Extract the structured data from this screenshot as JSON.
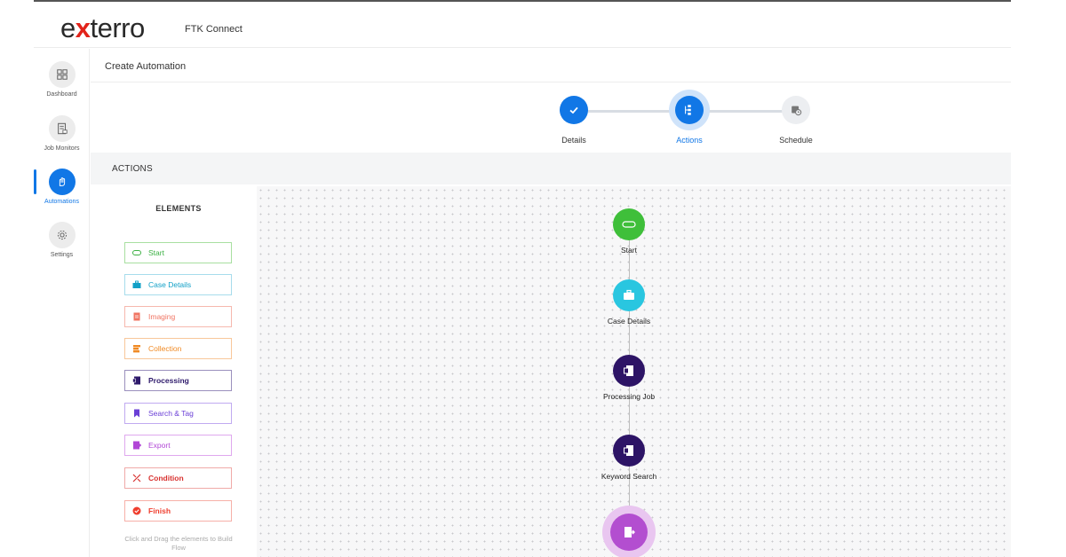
{
  "header": {
    "logo_pre": "e",
    "logo_x": "x",
    "logo_post": "terro",
    "product": "FTK Connect"
  },
  "sidebar": {
    "items": [
      {
        "label": "Dashboard",
        "icon": "dashboard-icon"
      },
      {
        "label": "Job Monitors",
        "icon": "job-monitor-icon"
      },
      {
        "label": "Automations",
        "icon": "automations-icon",
        "active": true
      },
      {
        "label": "Settings",
        "icon": "gear-icon"
      }
    ]
  },
  "page": {
    "title": "Create Automation"
  },
  "stepper": {
    "steps": [
      {
        "label": "Details",
        "state": "done",
        "icon": "check-icon"
      },
      {
        "label": "Actions",
        "state": "current",
        "icon": "flow-icon"
      },
      {
        "label": "Schedule",
        "state": "pending",
        "icon": "calendar-clock-icon"
      }
    ]
  },
  "actions": {
    "title": "ACTIONS",
    "elements_title": "ELEMENTS",
    "elements": [
      {
        "label": "Start",
        "color": "#3cb043",
        "icon": "start-icon"
      },
      {
        "label": "Case Details",
        "color": "#12a0c7",
        "icon": "briefcase-icon"
      },
      {
        "label": "Imaging",
        "color": "#f07462",
        "icon": "imaging-icon"
      },
      {
        "label": "Collection",
        "color": "#f08a24",
        "icon": "collection-icon"
      },
      {
        "label": "Processing",
        "color": "#2e1a6b",
        "icon": "processing-icon"
      },
      {
        "label": "Search & Tag",
        "color": "#6a3fd6",
        "icon": "bookmark-icon"
      },
      {
        "label": "Export",
        "color": "#b146d6",
        "icon": "export-icon"
      },
      {
        "label": "Condition",
        "color": "#d8312f",
        "icon": "condition-icon"
      },
      {
        "label": "Finish",
        "color": "#ef3e2e",
        "icon": "finish-icon"
      }
    ],
    "hint": "Click and Drag the elements to Build Flow"
  },
  "flow": {
    "nodes": [
      {
        "label": "Start",
        "color": "#3fbf3a",
        "icon": "start-icon"
      },
      {
        "label": "Case Details",
        "color": "#29c6e0",
        "icon": "briefcase-icon"
      },
      {
        "label": "Processing Job",
        "color": "#2d1466",
        "icon": "processing-icon"
      },
      {
        "label": "Keyword Search",
        "color": "#2d1466",
        "icon": "processing-icon"
      },
      {
        "label": "",
        "color": "#b34ed0",
        "icon": "export-icon"
      }
    ]
  }
}
